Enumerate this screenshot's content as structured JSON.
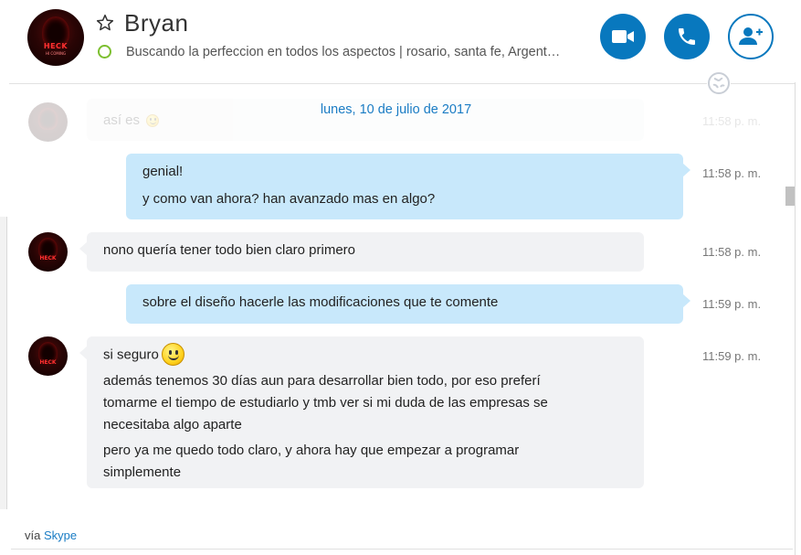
{
  "header": {
    "contact_name": "Bryan",
    "mood_message": "Buscando la perfeccion en todos los aspectos  |  rosario, santa fe, Argent…",
    "presence_color": "#7cbf2f",
    "avatar_logo": "HECK",
    "avatar_logo_sub": "HI COMING"
  },
  "date_separator": "lunes, 10 de julio de 2017",
  "messages": [
    {
      "direction": "incoming",
      "lines": [
        "así es"
      ],
      "time": "11:58 p. m.",
      "faded": true
    },
    {
      "direction": "outgoing",
      "lines": [
        "genial!",
        "y como van ahora? han avanzado mas en algo?"
      ],
      "time": "11:58 p. m."
    },
    {
      "direction": "incoming",
      "lines": [
        "nono  quería tener todo bien claro primero"
      ],
      "time": "11:58 p. m."
    },
    {
      "direction": "outgoing",
      "lines": [
        "sobre el diseño hacerle las modificaciones que te comente"
      ],
      "time": "11:59 p. m."
    },
    {
      "direction": "incoming",
      "lines": [
        "si seguro",
        "además tenemos 30 días aun para desarrollar bien todo, por eso preferí",
        "tomarme el tiempo de estudiarlo y tmb ver si mi duda de las empresas se",
        "necesitaba algo aparte",
        "pero ya me quedo todo claro, y ahora hay que empezar a programar",
        "simplemente"
      ],
      "time": "11:59 p. m."
    }
  ],
  "footer": {
    "via_prefix": "vía",
    "via_link": "Skype"
  },
  "colors": {
    "accent": "#0878be",
    "outgoing_bubble": "#c8e8fb",
    "incoming_bubble": "#f1f2f4",
    "link": "#1a7cc4"
  },
  "icons": [
    "star-icon",
    "video-camera-icon",
    "phone-icon",
    "add-person-icon",
    "globe-icon",
    "smiley-emoticon"
  ]
}
